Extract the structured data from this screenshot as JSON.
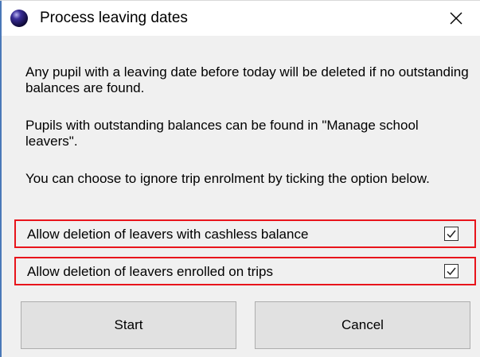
{
  "window": {
    "title": "Process leaving dates",
    "icon": "app-orb-icon",
    "close_icon": "close-icon"
  },
  "body": {
    "paragraphs": [
      "Any pupil with a leaving date before today will be deleted if no outstanding balances are found.",
      "Pupils with outstanding balances can be found in \"Manage school leavers\".",
      "You can choose to ignore trip enrolment by ticking the option below."
    ]
  },
  "options": [
    {
      "label": "Allow deletion of leavers with cashless balance",
      "checked": true
    },
    {
      "label": "Allow deletion of leavers enrolled on trips",
      "checked": true
    }
  ],
  "buttons": {
    "start": "Start",
    "cancel": "Cancel"
  },
  "colors": {
    "highlight_border": "#e8141b",
    "dialog_bg": "#f0f0f0",
    "button_bg": "#e1e1e1"
  }
}
